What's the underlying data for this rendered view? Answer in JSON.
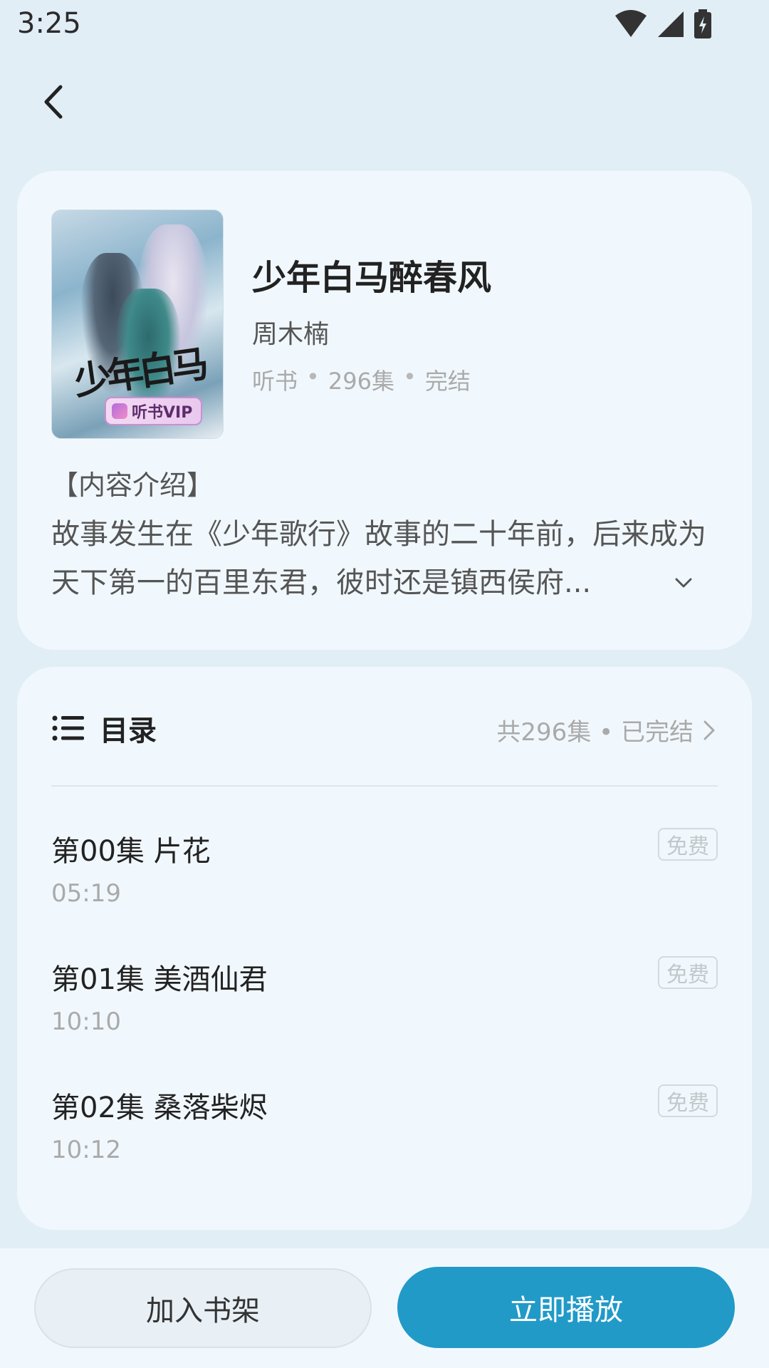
{
  "status_bar": {
    "time": "3:25",
    "icons": [
      "wifi-icon",
      "signal-icon",
      "battery-charging-icon"
    ]
  },
  "header": {
    "back_icon": "chevron-left-icon"
  },
  "book": {
    "cover_badge": "听书VIP",
    "title": "少年白马醉春风",
    "author": "周木楠",
    "meta": [
      "听书",
      "296集",
      "完结"
    ],
    "intro_heading": "【内容介绍】",
    "intro_text": "故事发生在《少年歌行》故事的二十年前，后来成为天下第一的百里东君，彼时还是镇西侯府...",
    "expand_icon": "chevron-down-icon"
  },
  "toc": {
    "title": "目录",
    "summary": "共296集 • 已完结",
    "episodes": [
      {
        "title": "第00集 片花",
        "duration": "05:19",
        "badge": "免费"
      },
      {
        "title": "第01集 美酒仙君",
        "duration": "10:10",
        "badge": "免费"
      },
      {
        "title": "第02集 桑落柴烬",
        "duration": "10:12",
        "badge": "免费"
      }
    ]
  },
  "actions": {
    "add_to_shelf": "加入书架",
    "play_now": "立即播放"
  },
  "colors": {
    "accent": "#219ac8",
    "background": "#e1eef6",
    "card": "#f1f8fd"
  }
}
